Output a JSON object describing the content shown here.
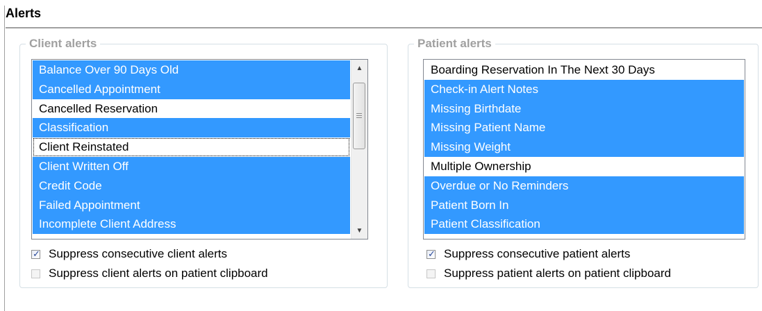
{
  "panel": {
    "title": "Alerts"
  },
  "client": {
    "legend": "Client alerts",
    "items": [
      {
        "label": "Balance Over 90 Days Old",
        "selected": true
      },
      {
        "label": "Cancelled Appointment",
        "selected": true
      },
      {
        "label": "Cancelled Reservation",
        "selected": false
      },
      {
        "label": "Classification",
        "selected": true
      },
      {
        "label": "Client Reinstated",
        "selected": false,
        "focused": true
      },
      {
        "label": "Client Written Off",
        "selected": true
      },
      {
        "label": "Credit Code",
        "selected": true
      },
      {
        "label": "Failed Appointment",
        "selected": true
      },
      {
        "label": "Incomplete Client Address",
        "selected": true
      }
    ],
    "suppress_consecutive": {
      "label": "Suppress consecutive client alerts",
      "checked": true
    },
    "suppress_clipboard": {
      "label": "Suppress client alerts on patient clipboard",
      "checked": false
    }
  },
  "patient": {
    "legend": "Patient alerts",
    "items": [
      {
        "label": "Boarding Reservation In The Next 30 Days",
        "selected": false
      },
      {
        "label": "Check-in Alert Notes",
        "selected": true
      },
      {
        "label": "Missing Birthdate",
        "selected": true
      },
      {
        "label": "Missing Patient Name",
        "selected": true
      },
      {
        "label": "Missing Weight",
        "selected": true
      },
      {
        "label": "Multiple Ownership",
        "selected": false
      },
      {
        "label": "Overdue or No Reminders",
        "selected": true
      },
      {
        "label": "Patient Born In",
        "selected": true
      },
      {
        "label": "Patient Classification",
        "selected": true
      }
    ],
    "suppress_consecutive": {
      "label": "Suppress consecutive patient alerts",
      "checked": true
    },
    "suppress_clipboard": {
      "label": "Suppress patient alerts on patient clipboard",
      "checked": false
    }
  },
  "colors": {
    "selection": "#3399ff",
    "legend_text": "#a0a0a0",
    "group_border": "#d5dfe5"
  },
  "icons": {
    "scroll_up": "up-arrow-icon",
    "scroll_down": "down-arrow-icon",
    "checkmark": "checkmark-icon"
  }
}
